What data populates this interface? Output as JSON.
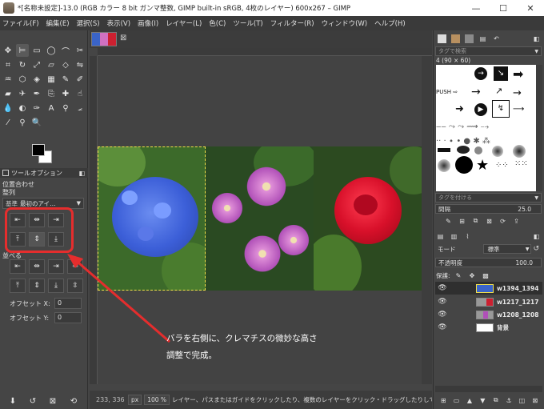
{
  "window": {
    "title": "*[名称未設定]-13.0 (RGB カラー 8 bit ガンマ整数, GIMP built-in sRGB, 4枚のレイヤー) 600x267 – GIMP",
    "minimize": "—",
    "maximize": "☐",
    "close": "✕"
  },
  "menu": [
    "ファイル(F)",
    "編集(E)",
    "選択(S)",
    "表示(V)",
    "画像(I)",
    "レイヤー(L)",
    "色(C)",
    "ツール(T)",
    "フィルター(R)",
    "ウィンドウ(W)",
    "ヘルプ(H)"
  ],
  "tool_options": {
    "tab_label": "ツールオプション",
    "section_title": "位置合わせ",
    "align_label": "整列",
    "relative_to": "最初のアイ…",
    "relative_prefix": "基準",
    "distribute_label": "並べる",
    "offset_x_label": "オフセット X:",
    "offset_x_value": "0",
    "offset_y_label": "オフセット Y:",
    "offset_y_value": "0"
  },
  "canvas": {
    "annotation_line1": "バラを右側に、クレマチスの微妙な高さ",
    "annotation_line2": "調整で完成。"
  },
  "statusbar": {
    "coords": "233, 336",
    "unit": "px",
    "zoom": "100 %",
    "message": "レイヤー、パスまたはガイドをクリックしたり、複数のレイヤーをクリック・ドラッグしたりして整列対…"
  },
  "brushes": {
    "tag_placeholder": "タグで検索",
    "brush_name": "4 (90 × 60)",
    "tag_assign": "タグを付ける",
    "spacing_label": "間隔",
    "spacing_value": "25.0"
  },
  "layers": {
    "mode_label": "モード",
    "mode_value": "標準",
    "opacity_label": "不透明度",
    "opacity_value": "100.0",
    "lock_label": "保護:",
    "items": [
      {
        "name": "w1394_1394",
        "selected": true
      },
      {
        "name": "w1217_1217",
        "selected": false
      },
      {
        "name": "w1208_1208",
        "selected": false
      },
      {
        "name": "背景",
        "selected": false
      }
    ]
  },
  "colors": {
    "annotation": "#e52d2d",
    "bg": "#454545"
  }
}
